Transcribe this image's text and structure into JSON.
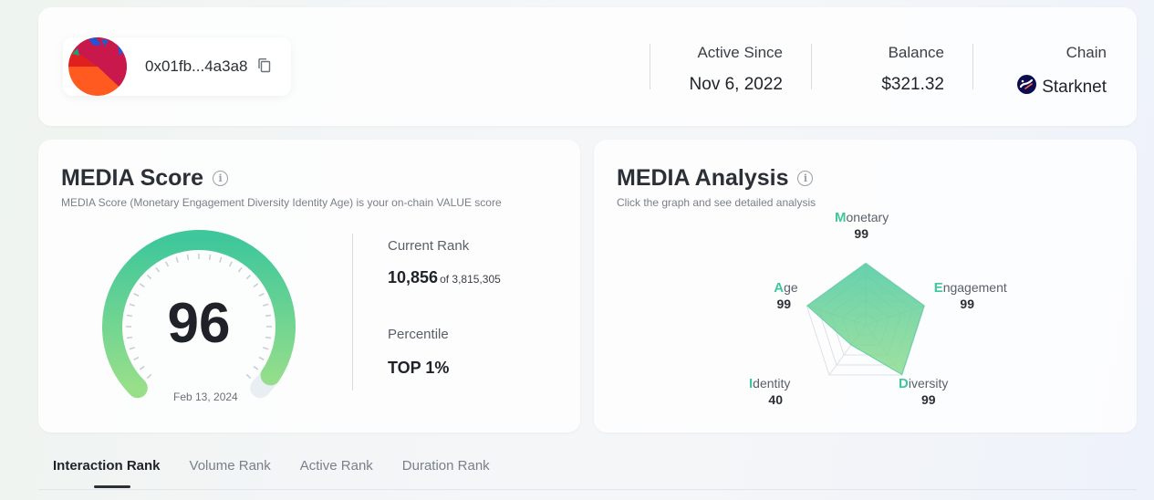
{
  "header": {
    "address": "0x01fb...4a3a8",
    "stats": [
      {
        "label": "Active Since",
        "value": "Nov 6, 2022"
      },
      {
        "label": "Balance",
        "value": "$321.32"
      },
      {
        "label": "Chain",
        "value": "Starknet",
        "icon": "starknet-icon"
      }
    ]
  },
  "score": {
    "title": "MEDIA Score",
    "subtitle": "MEDIA Score (Monetary Engagement Diversity Identity Age) is your on-chain VALUE score",
    "value": "96",
    "date": "Feb 13, 2024",
    "current_rank_label": "Current Rank",
    "rank": "10,856",
    "rank_of": "of 3,815,305",
    "percentile_label": "Percentile",
    "percentile": "TOP 1%"
  },
  "analysis": {
    "title": "MEDIA Analysis",
    "subtitle": "Click the graph and see detailed analysis",
    "axes": [
      {
        "initial": "M",
        "rest": "onetary",
        "value": "99"
      },
      {
        "initial": "E",
        "rest": "ngagement",
        "value": "99"
      },
      {
        "initial": "D",
        "rest": "iversity",
        "value": "99"
      },
      {
        "initial": "I",
        "rest": "dentity",
        "value": "40"
      },
      {
        "initial": "A",
        "rest": "ge",
        "value": "99"
      }
    ]
  },
  "tabs": [
    "Interaction Rank",
    "Volume Rank",
    "Active Rank",
    "Duration Rank"
  ],
  "colors": {
    "accent": "#3fc79b",
    "accent_light": "#8ed98e"
  }
}
